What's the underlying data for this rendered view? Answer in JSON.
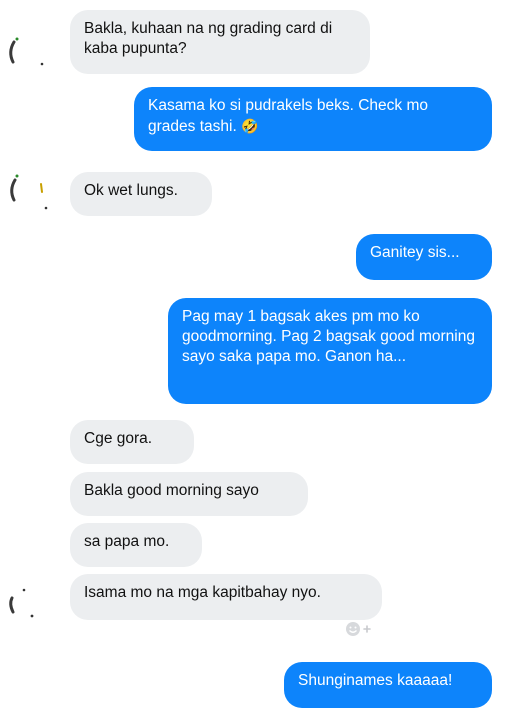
{
  "messages": [
    {
      "sender": "them",
      "text": "Bakla, kuhaan na ng grading card di kaba pupunta?"
    },
    {
      "sender": "me",
      "text": "Kasama ko si pudrakels beks. Check mo grades tashi.",
      "emoji": "🤣"
    },
    {
      "sender": "them",
      "text": "Ok wet lungs."
    },
    {
      "sender": "me",
      "text": "Ganitey sis..."
    },
    {
      "sender": "me",
      "text": "Pag may 1 bagsak akes pm mo ko goodmorning. Pag 2 bagsak good morning sayo saka papa mo. Ganon ha..."
    },
    {
      "sender": "them",
      "text": "Cge gora."
    },
    {
      "sender": "them",
      "text": "Bakla good morning sayo"
    },
    {
      "sender": "them",
      "text": "sa papa mo."
    },
    {
      "sender": "them",
      "text": "Isama mo na mga kapitbahay nyo."
    },
    {
      "sender": "me",
      "text": "Shunginames kaaaaa!"
    }
  ],
  "reaction": {
    "icon": "add-reaction-icon",
    "symbol": "☺+"
  },
  "colors": {
    "outgoing": "#0d84fb",
    "incoming": "#eceef0",
    "background": "#ffffff"
  }
}
